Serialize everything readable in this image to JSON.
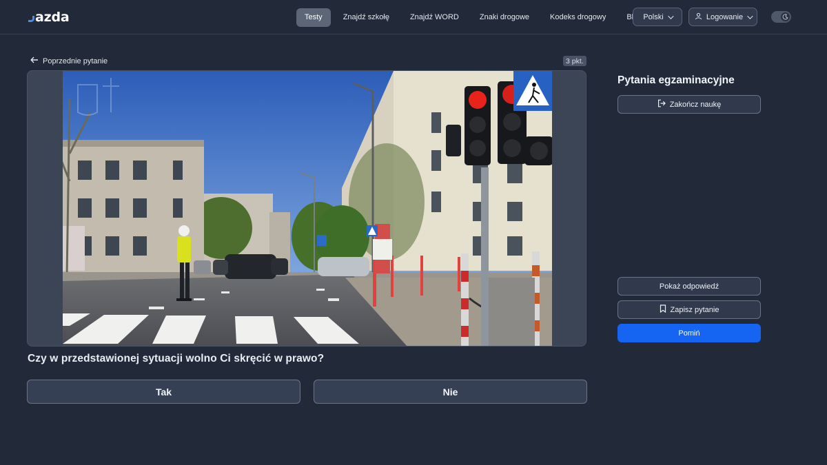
{
  "brand": {
    "logo_text": "azda",
    "accent": "#4a8df0"
  },
  "nav": {
    "items": [
      {
        "label": "Testy",
        "active": true
      },
      {
        "label": "Znajdź szkołę"
      },
      {
        "label": "Znajdź WORD"
      },
      {
        "label": "Znaki drogowe"
      },
      {
        "label": "Kodeks drogowy"
      },
      {
        "label": "Blog"
      }
    ],
    "language": "Polski",
    "login": "Logowanie",
    "theme_toggle_icon": "moon-icon"
  },
  "question": {
    "prev_label": "Poprzednie pytanie",
    "points": "3 pkt.",
    "text": "Czy w przedstawionej sytuacji wolno Ci skręcić w prawo?",
    "answers": [
      "Tak",
      "Nie"
    ]
  },
  "sidebar": {
    "title": "Pytania egzaminacyjne",
    "end_label": "Zakończ naukę",
    "show_answer_label": "Pokaż odpowiedź",
    "save_label": "Zapisz pytanie",
    "skip_label": "Pomiń",
    "primary_color": "#1565f2"
  }
}
